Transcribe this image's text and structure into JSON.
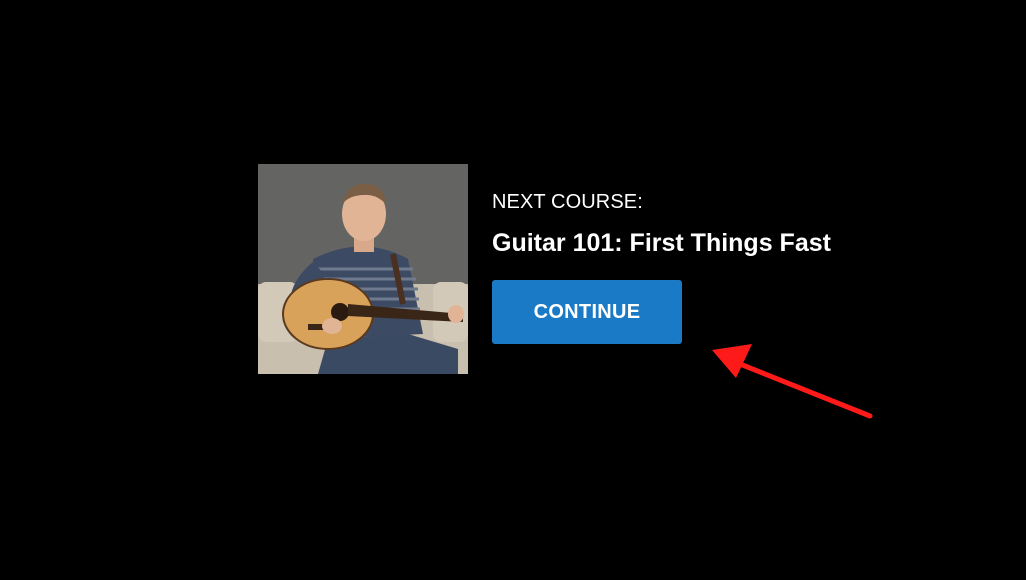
{
  "promo": {
    "thumbnail_icon": "instructor-with-guitar-photo",
    "next_label": "NEXT COURSE:",
    "course_title": "Guitar 101: First Things Fast",
    "continue_label": "CONTINUE"
  },
  "annotation": {
    "arrow_icon": "red-arrow-icon",
    "arrow_color": "#ff1a1a"
  },
  "colors": {
    "background": "#000000",
    "button": "#1a7ac6",
    "text": "#ffffff"
  }
}
